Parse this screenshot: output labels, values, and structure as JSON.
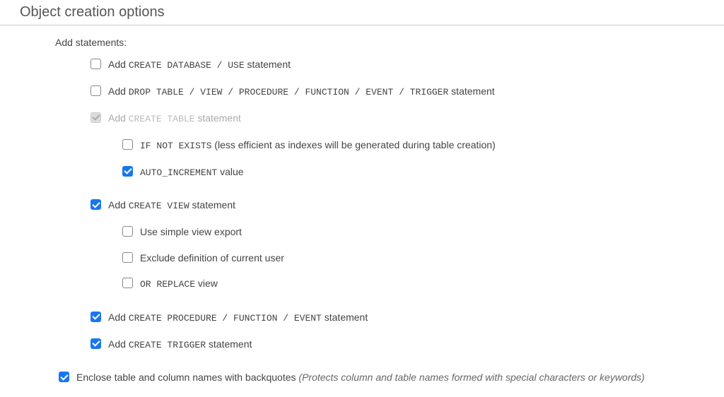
{
  "section_title": "Object creation options",
  "group_label": "Add statements:",
  "options": {
    "create_database": {
      "pre": "Add ",
      "code": "CREATE DATABASE / USE",
      "post": " statement",
      "checked": false,
      "disabled": false
    },
    "drop_table": {
      "pre": "Add ",
      "code": "DROP TABLE / VIEW / PROCEDURE / FUNCTION / EVENT / TRIGGER",
      "post": " statement",
      "checked": false,
      "disabled": false
    },
    "create_table": {
      "pre": "Add ",
      "code": "CREATE TABLE",
      "post": " statement",
      "checked": true,
      "disabled": true
    },
    "if_not_exists": {
      "code": "IF NOT EXISTS",
      "post": " (less efficient as indexes will be generated during table creation)",
      "checked": false,
      "disabled": false
    },
    "auto_increment": {
      "code": "AUTO_INCREMENT",
      "post": " value",
      "checked": true,
      "disabled": false
    },
    "create_view": {
      "pre": "Add ",
      "code": "CREATE VIEW",
      "post": " statement",
      "checked": true,
      "disabled": false
    },
    "simple_view": {
      "text": "Use simple view export",
      "checked": false,
      "disabled": false
    },
    "exclude_def": {
      "text": "Exclude definition of current user",
      "checked": false,
      "disabled": false
    },
    "or_replace": {
      "code": "OR REPLACE",
      "post": " view",
      "checked": false,
      "disabled": false
    },
    "create_procedure": {
      "pre": "Add ",
      "code": "CREATE PROCEDURE / FUNCTION / EVENT",
      "post": " statement",
      "checked": true,
      "disabled": false
    },
    "create_trigger": {
      "pre": "Add ",
      "code": "CREATE TRIGGER",
      "post": " statement",
      "checked": true,
      "disabled": false
    },
    "backquotes": {
      "text": "Enclose table and column names with backquotes ",
      "paren": "(Protects column and table names formed with special characters or keywords)",
      "checked": true,
      "disabled": false
    }
  }
}
